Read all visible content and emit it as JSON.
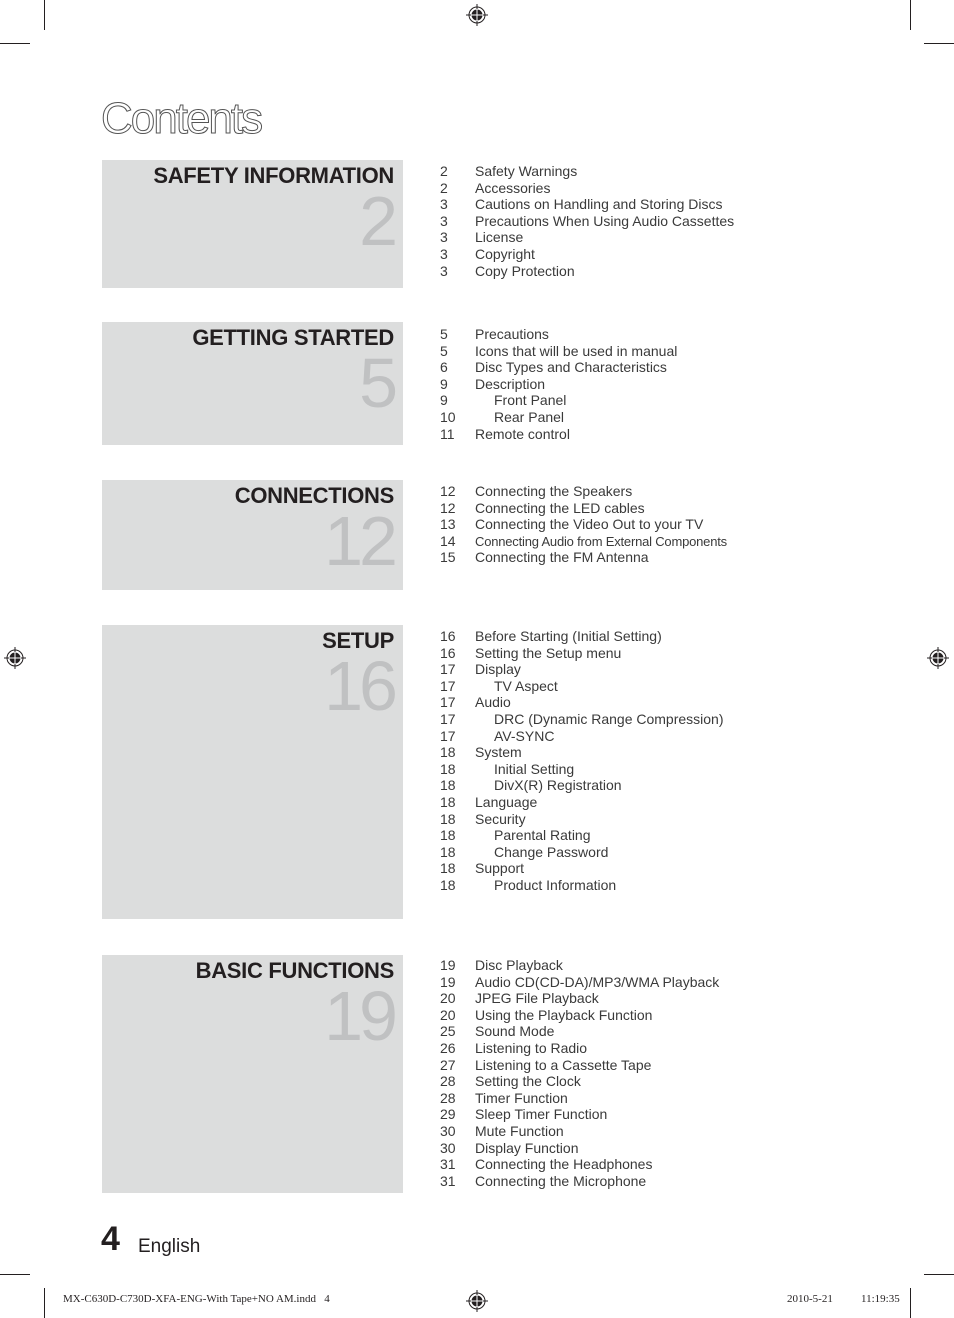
{
  "page": {
    "title": "Contents",
    "page_number": "4",
    "language": "English"
  },
  "sections": [
    {
      "title": "SAFETY INFORMATION",
      "number": "2",
      "entries": [
        {
          "page": "2",
          "label": "Safety Warnings",
          "level": 0
        },
        {
          "page": "2",
          "label": "Accessories",
          "level": 0
        },
        {
          "page": "3",
          "label": "Cautions on Handling and Storing Discs",
          "level": 0
        },
        {
          "page": "3",
          "label": "Precautions When Using Audio Cassettes",
          "level": 0
        },
        {
          "page": "3",
          "label": "License",
          "level": 0
        },
        {
          "page": "3",
          "label": "Copyright",
          "level": 0
        },
        {
          "page": "3",
          "label": "Copy Protection",
          "level": 0
        }
      ]
    },
    {
      "title": "GETTING STARTED",
      "number": "5",
      "entries": [
        {
          "page": "5",
          "label": "Precautions",
          "level": 0
        },
        {
          "page": "5",
          "label": "Icons that will be used in manual",
          "level": 0
        },
        {
          "page": "6",
          "label": "Disc Types and Characteristics",
          "level": 0
        },
        {
          "page": "9",
          "label": "Description",
          "level": 0
        },
        {
          "page": "9",
          "label": "Front Panel",
          "level": 1
        },
        {
          "page": "10",
          "label": "Rear Panel",
          "level": 1
        },
        {
          "page": "11",
          "label": "Remote control",
          "level": 0
        }
      ]
    },
    {
      "title": "CONNECTIONS",
      "number": "12",
      "entries": [
        {
          "page": "12",
          "label": "Connecting the Speakers",
          "level": 0
        },
        {
          "page": "12",
          "label": "Connecting the LED cables",
          "level": 0
        },
        {
          "page": "13",
          "label": "Connecting the Video Out to your TV",
          "level": 0
        },
        {
          "page": "14",
          "label": "Connecting Audio from External Components",
          "level": 0,
          "small": true
        },
        {
          "page": "15",
          "label": "Connecting the FM Antenna",
          "level": 0
        }
      ]
    },
    {
      "title": "SETUP",
      "number": "16",
      "entries": [
        {
          "page": "16",
          "label": "Before Starting (Initial Setting)",
          "level": 0
        },
        {
          "page": "16",
          "label": "Setting the Setup menu",
          "level": 0
        },
        {
          "page": "17",
          "label": "Display",
          "level": 0
        },
        {
          "page": "17",
          "label": "TV Aspect",
          "level": 1
        },
        {
          "page": "17",
          "label": "Audio",
          "level": 0
        },
        {
          "page": "17",
          "label": "DRC (Dynamic Range Compression)",
          "level": 1
        },
        {
          "page": "17",
          "label": "AV-SYNC",
          "level": 1
        },
        {
          "page": "18",
          "label": "System",
          "level": 0
        },
        {
          "page": "18",
          "label": "Initial Setting",
          "level": 1
        },
        {
          "page": "18",
          "label": "DivX(R) Registration",
          "level": 1
        },
        {
          "page": "18",
          "label": "Language",
          "level": 0
        },
        {
          "page": "18",
          "label": "Security",
          "level": 0
        },
        {
          "page": "18",
          "label": "Parental Rating",
          "level": 1
        },
        {
          "page": "18",
          "label": "Change Password",
          "level": 1
        },
        {
          "page": "18",
          "label": "Support",
          "level": 0
        },
        {
          "page": "18",
          "label": "Product Information",
          "level": 1
        }
      ]
    },
    {
      "title": "BASIC FUNCTIONS",
      "number": "19",
      "entries": [
        {
          "page": "19",
          "label": "Disc Playback",
          "level": 0
        },
        {
          "page": "19",
          "label": "Audio CD(CD-DA)/MP3/WMA Playback",
          "level": 0
        },
        {
          "page": "20",
          "label": "JPEG File Playback",
          "level": 0
        },
        {
          "page": "20",
          "label": "Using the Playback Function",
          "level": 0
        },
        {
          "page": "25",
          "label": "Sound Mode",
          "level": 0
        },
        {
          "page": "26",
          "label": "Listening to Radio",
          "level": 0
        },
        {
          "page": "27",
          "label": "Listening to a Cassette Tape",
          "level": 0
        },
        {
          "page": "28",
          "label": "Setting the Clock",
          "level": 0
        },
        {
          "page": "28",
          "label": "Timer Function",
          "level": 0
        },
        {
          "page": "29",
          "label": "Sleep Timer Function",
          "level": 0
        },
        {
          "page": "30",
          "label": "Mute Function",
          "level": 0
        },
        {
          "page": "30",
          "label": "Display Function",
          "level": 0
        },
        {
          "page": "31",
          "label": "Connecting the Headphones",
          "level": 0
        },
        {
          "page": "31",
          "label": "Connecting the Microphone",
          "level": 0
        }
      ]
    }
  ],
  "slug": {
    "file": "MX-C630D-C730D-XFA-ENG-With Tape+NO AM.indd   4",
    "date": "2010-5-21",
    "time": "11:19:35"
  },
  "colors": {
    "panel_bg": "#dcdddd",
    "panel_number": "#c0c1c2",
    "text": "#231f20"
  }
}
